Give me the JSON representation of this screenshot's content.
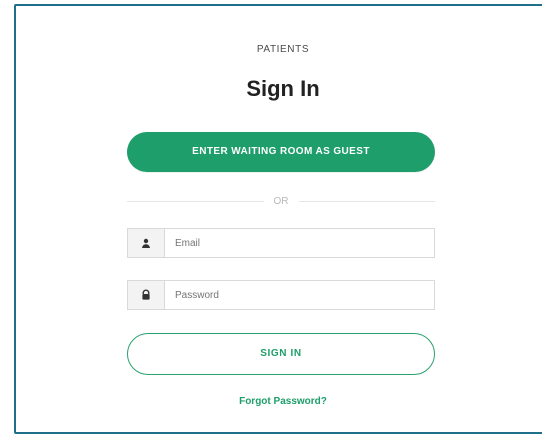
{
  "header": {
    "kicker": "PATIENTS",
    "title": "Sign In"
  },
  "guest": {
    "label": "ENTER WAITING ROOM AS GUEST"
  },
  "divider": {
    "label": "OR"
  },
  "form": {
    "email": {
      "placeholder": "Email",
      "icon": "user-icon"
    },
    "password": {
      "placeholder": "Password",
      "icon": "lock-icon"
    }
  },
  "actions": {
    "signin_label": "SIGN IN",
    "forgot_label": "Forgot Password?"
  },
  "colors": {
    "primary_green": "#1e9e6a",
    "frame_blue": "#1f6f8b"
  }
}
